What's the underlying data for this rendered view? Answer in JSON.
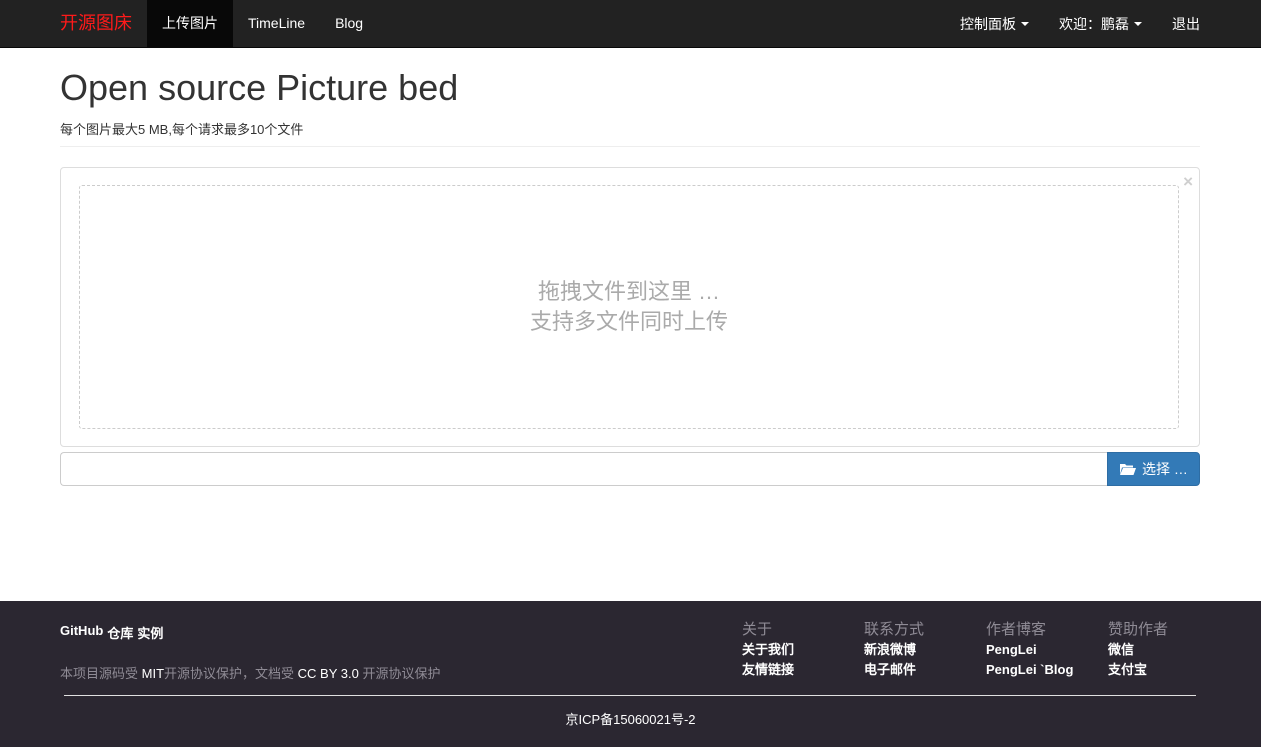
{
  "navbar": {
    "brand": "开源图床",
    "left_items": [
      "上传图片",
      "TimeLine",
      "Blog"
    ],
    "right_items": [
      {
        "label": "控制面板",
        "dropdown": true
      },
      {
        "label": "欢迎：鹏磊",
        "dropdown": true
      },
      {
        "label": "退出",
        "dropdown": false
      }
    ],
    "brand_color": "#ff1a1a",
    "bg_color": "#222222"
  },
  "header": {
    "title": "Open source Picture bed",
    "subtitle": "每个图片最大5 MB,每个请求最多10个文件"
  },
  "dropzone": {
    "close_symbol": "×",
    "line1": "拖拽文件到这里 …",
    "line2": "支持多文件同时上传"
  },
  "file_input": {
    "caption": "",
    "browse_label": "选择 …",
    "browse_icon": "folder-open-icon",
    "accent_color": "#337ab7"
  },
  "footer": {
    "links": [
      "GitHub",
      "仓库",
      "实例"
    ],
    "license": {
      "p1": "本项目源码受 ",
      "mit": "MIT",
      "p2": "开源协议保护，文档受 ",
      "cc": "CC BY 3.0",
      "p3": " 开源协议保护"
    },
    "columns": [
      {
        "title": "关于",
        "links": [
          "关于我们",
          "友情链接"
        ]
      },
      {
        "title": "联系方式",
        "links": [
          "新浪微博",
          "电子邮件"
        ]
      },
      {
        "title": "作者博客",
        "links": [
          "PengLei",
          "PengLei `Blog"
        ]
      },
      {
        "title": "赞助作者",
        "links": [
          "微信",
          "支付宝"
        ]
      }
    ],
    "icp": "京ICP备15060021号-2",
    "bg_color": "#2b2731"
  }
}
